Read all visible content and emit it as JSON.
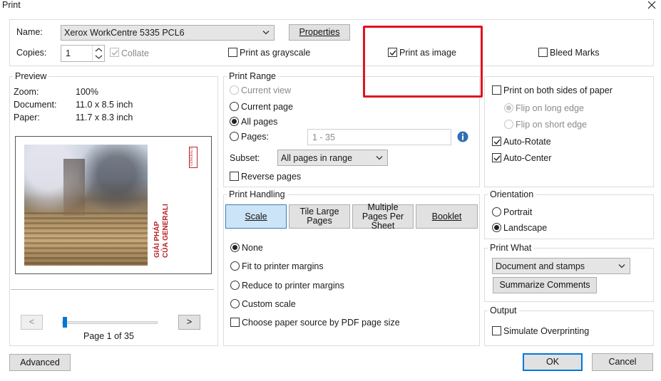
{
  "window": {
    "title": "Print"
  },
  "printer": {
    "name_label": "Name:",
    "name_value": "Xerox WorkCentre 5335 PCL6",
    "properties_label": "Properties",
    "copies_label": "Copies:",
    "copies_value": "1",
    "collate_label": "Collate",
    "grayscale_label": "Print as grayscale",
    "print_as_image_label": "Print as image",
    "bleed_marks_label": "Bleed Marks"
  },
  "preview": {
    "title": "Preview",
    "zoom_label": "Zoom:",
    "zoom_value": "100%",
    "document_label": "Document:",
    "document_value": "11.0 x 8.5 inch",
    "paper_label": "Paper:",
    "paper_value": "11.7 x 8.3 inch",
    "page_text_main": "GIẢI PHÁP",
    "page_text_sub": "CỦA GENERALI",
    "page_logo": "GENERALI",
    "prev_label": "<",
    "next_label": ">",
    "page_indicator": "Page 1 of 35"
  },
  "print_range": {
    "title": "Print Range",
    "current_view": "Current view",
    "current_page": "Current page",
    "all_pages": "All pages",
    "pages": "Pages:",
    "pages_value": "1 - 35",
    "subset_label": "Subset:",
    "subset_value": "All pages in range",
    "reverse_pages": "Reverse pages"
  },
  "print_handling": {
    "title": "Print Handling",
    "tabs": [
      "Scale",
      "Tile Large Pages",
      "Multiple Pages Per Sheet",
      "Booklet"
    ],
    "none": "None",
    "fit": "Fit to printer margins",
    "reduce": "Reduce to printer margins",
    "custom": "Custom scale",
    "paper_source": "Choose paper source by PDF page size"
  },
  "sides": {
    "both_sides": "Print on both sides of paper",
    "flip_long": "Flip on long edge",
    "flip_short": "Flip on short edge",
    "auto_rotate": "Auto-Rotate",
    "auto_center": "Auto-Center"
  },
  "orientation": {
    "title": "Orientation",
    "portrait": "Portrait",
    "landscape": "Landscape"
  },
  "print_what": {
    "title": "Print What",
    "value": "Document and stamps",
    "summarize": "Summarize Comments"
  },
  "output": {
    "title": "Output",
    "simulate": "Simulate Overprinting"
  },
  "footer": {
    "advanced": "Advanced",
    "ok": "OK",
    "cancel": "Cancel"
  },
  "colors": {
    "highlight": "#e0131f",
    "accent": "#0078d7",
    "brand_red": "#b8242a"
  },
  "icons": [
    "close-icon",
    "chevron-down-icon",
    "spinner-up-icon",
    "spinner-down-icon",
    "info-icon",
    "checkmark-icon"
  ]
}
